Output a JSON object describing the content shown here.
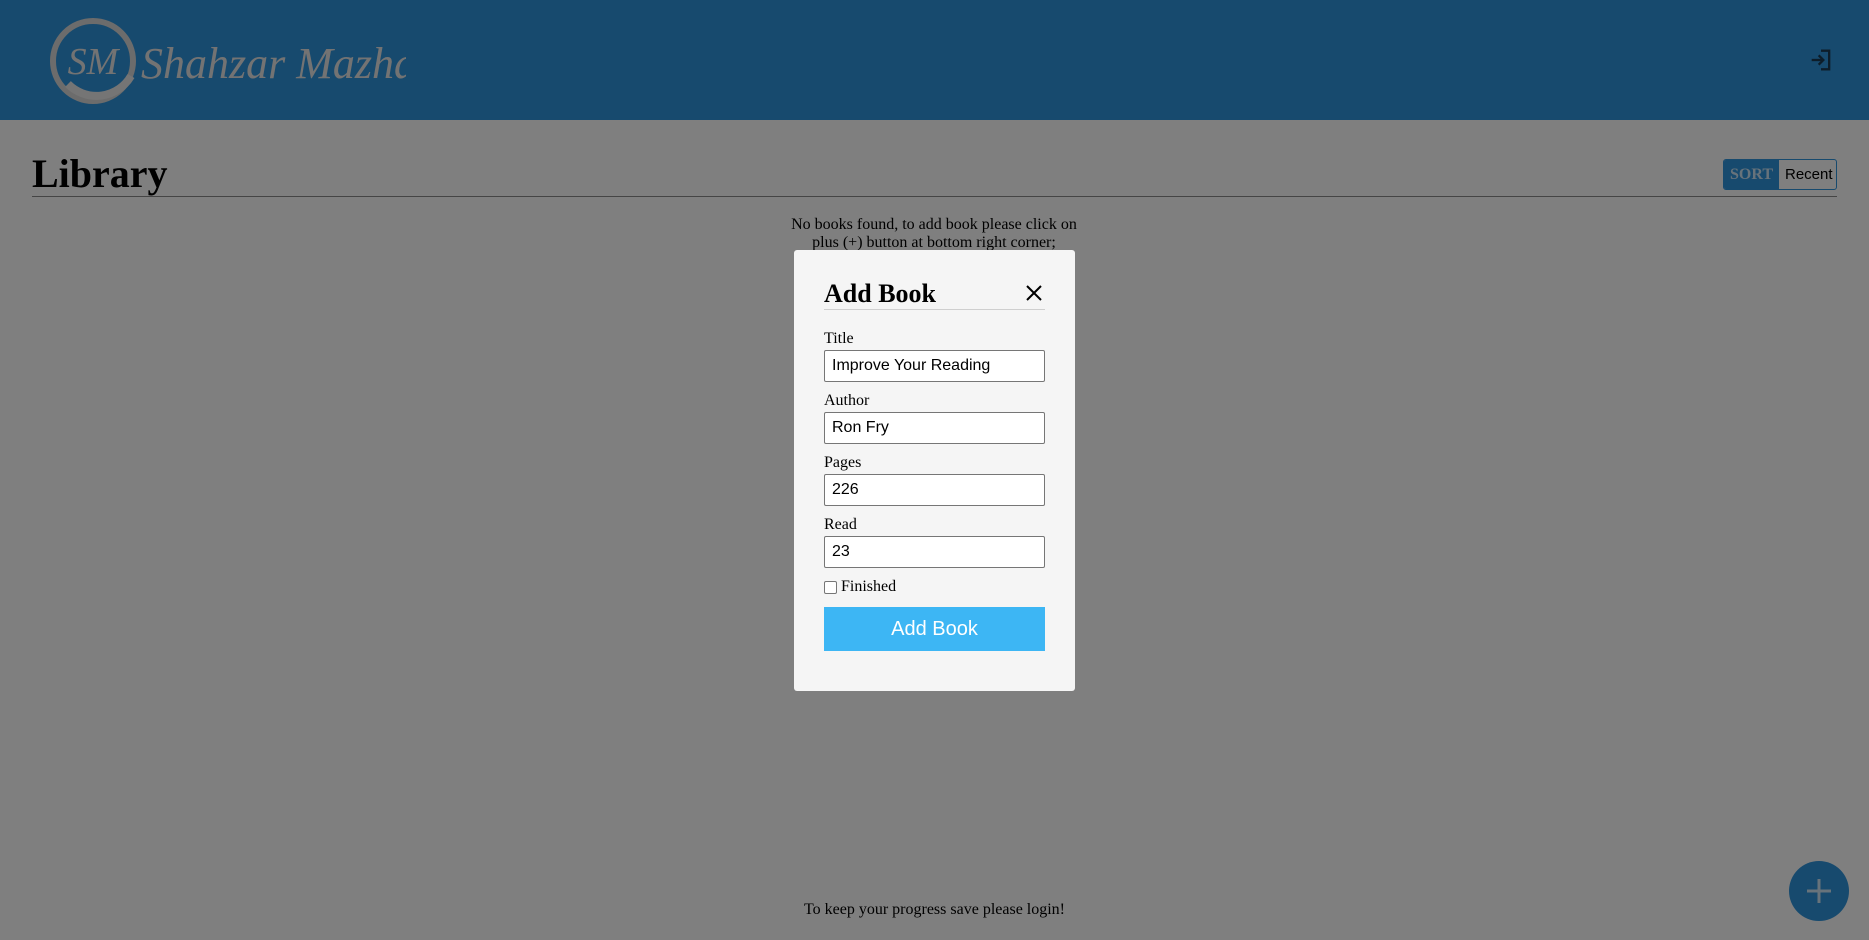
{
  "header": {
    "logo_monogram": "SM",
    "logo_text": "Shahzar Mazhar",
    "login_icon": "login-icon"
  },
  "library": {
    "title": "Library",
    "sort_label": "SORT",
    "sort_value": "Recent",
    "empty_message": "No books found, to add book please click on plus (+) button at bottom right corner;",
    "footer_message": "To keep your progress save please login!",
    "fab_icon": "plus-icon"
  },
  "modal": {
    "title": "Add Book",
    "close_icon": "close-icon",
    "fields": {
      "title_label": "Title",
      "title_value": "Improve Your Reading",
      "author_label": "Author",
      "author_value": "Ron Fry",
      "pages_label": "Pages",
      "pages_value": "226",
      "read_label": "Read",
      "read_value": "23"
    },
    "finished_label": "Finished",
    "finished_checked": false,
    "submit_label": "Add Book"
  },
  "colors": {
    "header_bg": "#2f94dc",
    "button_bg": "#3db6f4",
    "overlay": "rgba(0,0,0,0.5)"
  }
}
